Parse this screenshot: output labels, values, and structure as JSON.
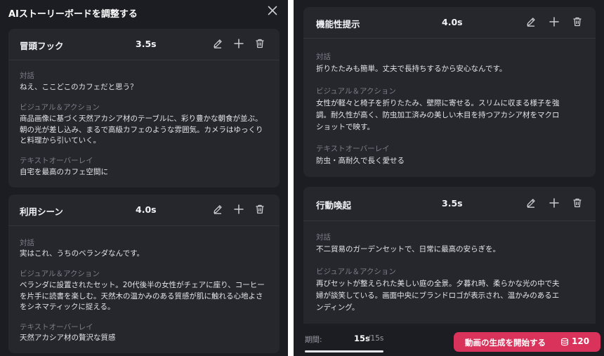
{
  "dialog": {
    "title": "AIストーリーボードを調整する"
  },
  "labels": {
    "dialogue": "対話",
    "visual_action": "ビジュアル＆アクション",
    "text_overlay": "テキストオーバーレイ"
  },
  "scenes": [
    {
      "name": "冒頭フック",
      "duration": "3.5s",
      "dialogue": "ねえ、ここどこのカフェだと思う？",
      "visual": [
        "商品画像に基づく天然アカシア材のテーブルに、彩り豊かな朝食が並ぶ。",
        "朝の光が差し込み、まるで高級カフェのような雰囲気。カメラはゆっくり",
        "と料理から引いていく。"
      ],
      "overlay": "自宅を最高のカフェ空間に"
    },
    {
      "name": "利用シーン",
      "duration": "4.0s",
      "dialogue": "実はこれ、うちのベランダなんです。",
      "visual": [
        "ベランダに設置されたセット。20代後半の女性がチェアに座り、コーヒー",
        "を片手に読書を楽しむ。天然木の温かみのある質感が肌に触れる心地よさ",
        "をシネマティックに捉える。"
      ],
      "overlay": "天然アカシア材の贅沢な質感"
    },
    {
      "name": "機能性提示",
      "duration": "4.0s",
      "dialogue": "折りたたみも簡単。丈夫で長持ちするから安心なんです。",
      "visual": [
        "女性が軽々と椅子を折りたたみ、壁際に寄せる。スリムに収まる様子を強",
        "調。耐久性が高く、防虫加工済みの美しい木目を持つアカシア材をマクロ",
        "ショットで映す。"
      ],
      "overlay": "防虫・高耐久で長く愛せる"
    },
    {
      "name": "行動喚起",
      "duration": "3.5s",
      "dialogue": "不二貿易のガーデンセットで、日常に最高の安らぎを。",
      "visual": [
        "再びセットが整えられた美しい庭の全景。夕暮れ時、柔らかな光の中で夫",
        "婦が談笑している。画面中央にブランドロゴが表示され、温かみのあるエ",
        "ンディング。"
      ]
    }
  ],
  "footer": {
    "period_label": "期間:",
    "current": "15s",
    "total": "/15s",
    "progress_fraction": 1.0,
    "generate_label": "動画の生成を開始する",
    "credits": "120",
    "accent_color": "#d9325b"
  }
}
